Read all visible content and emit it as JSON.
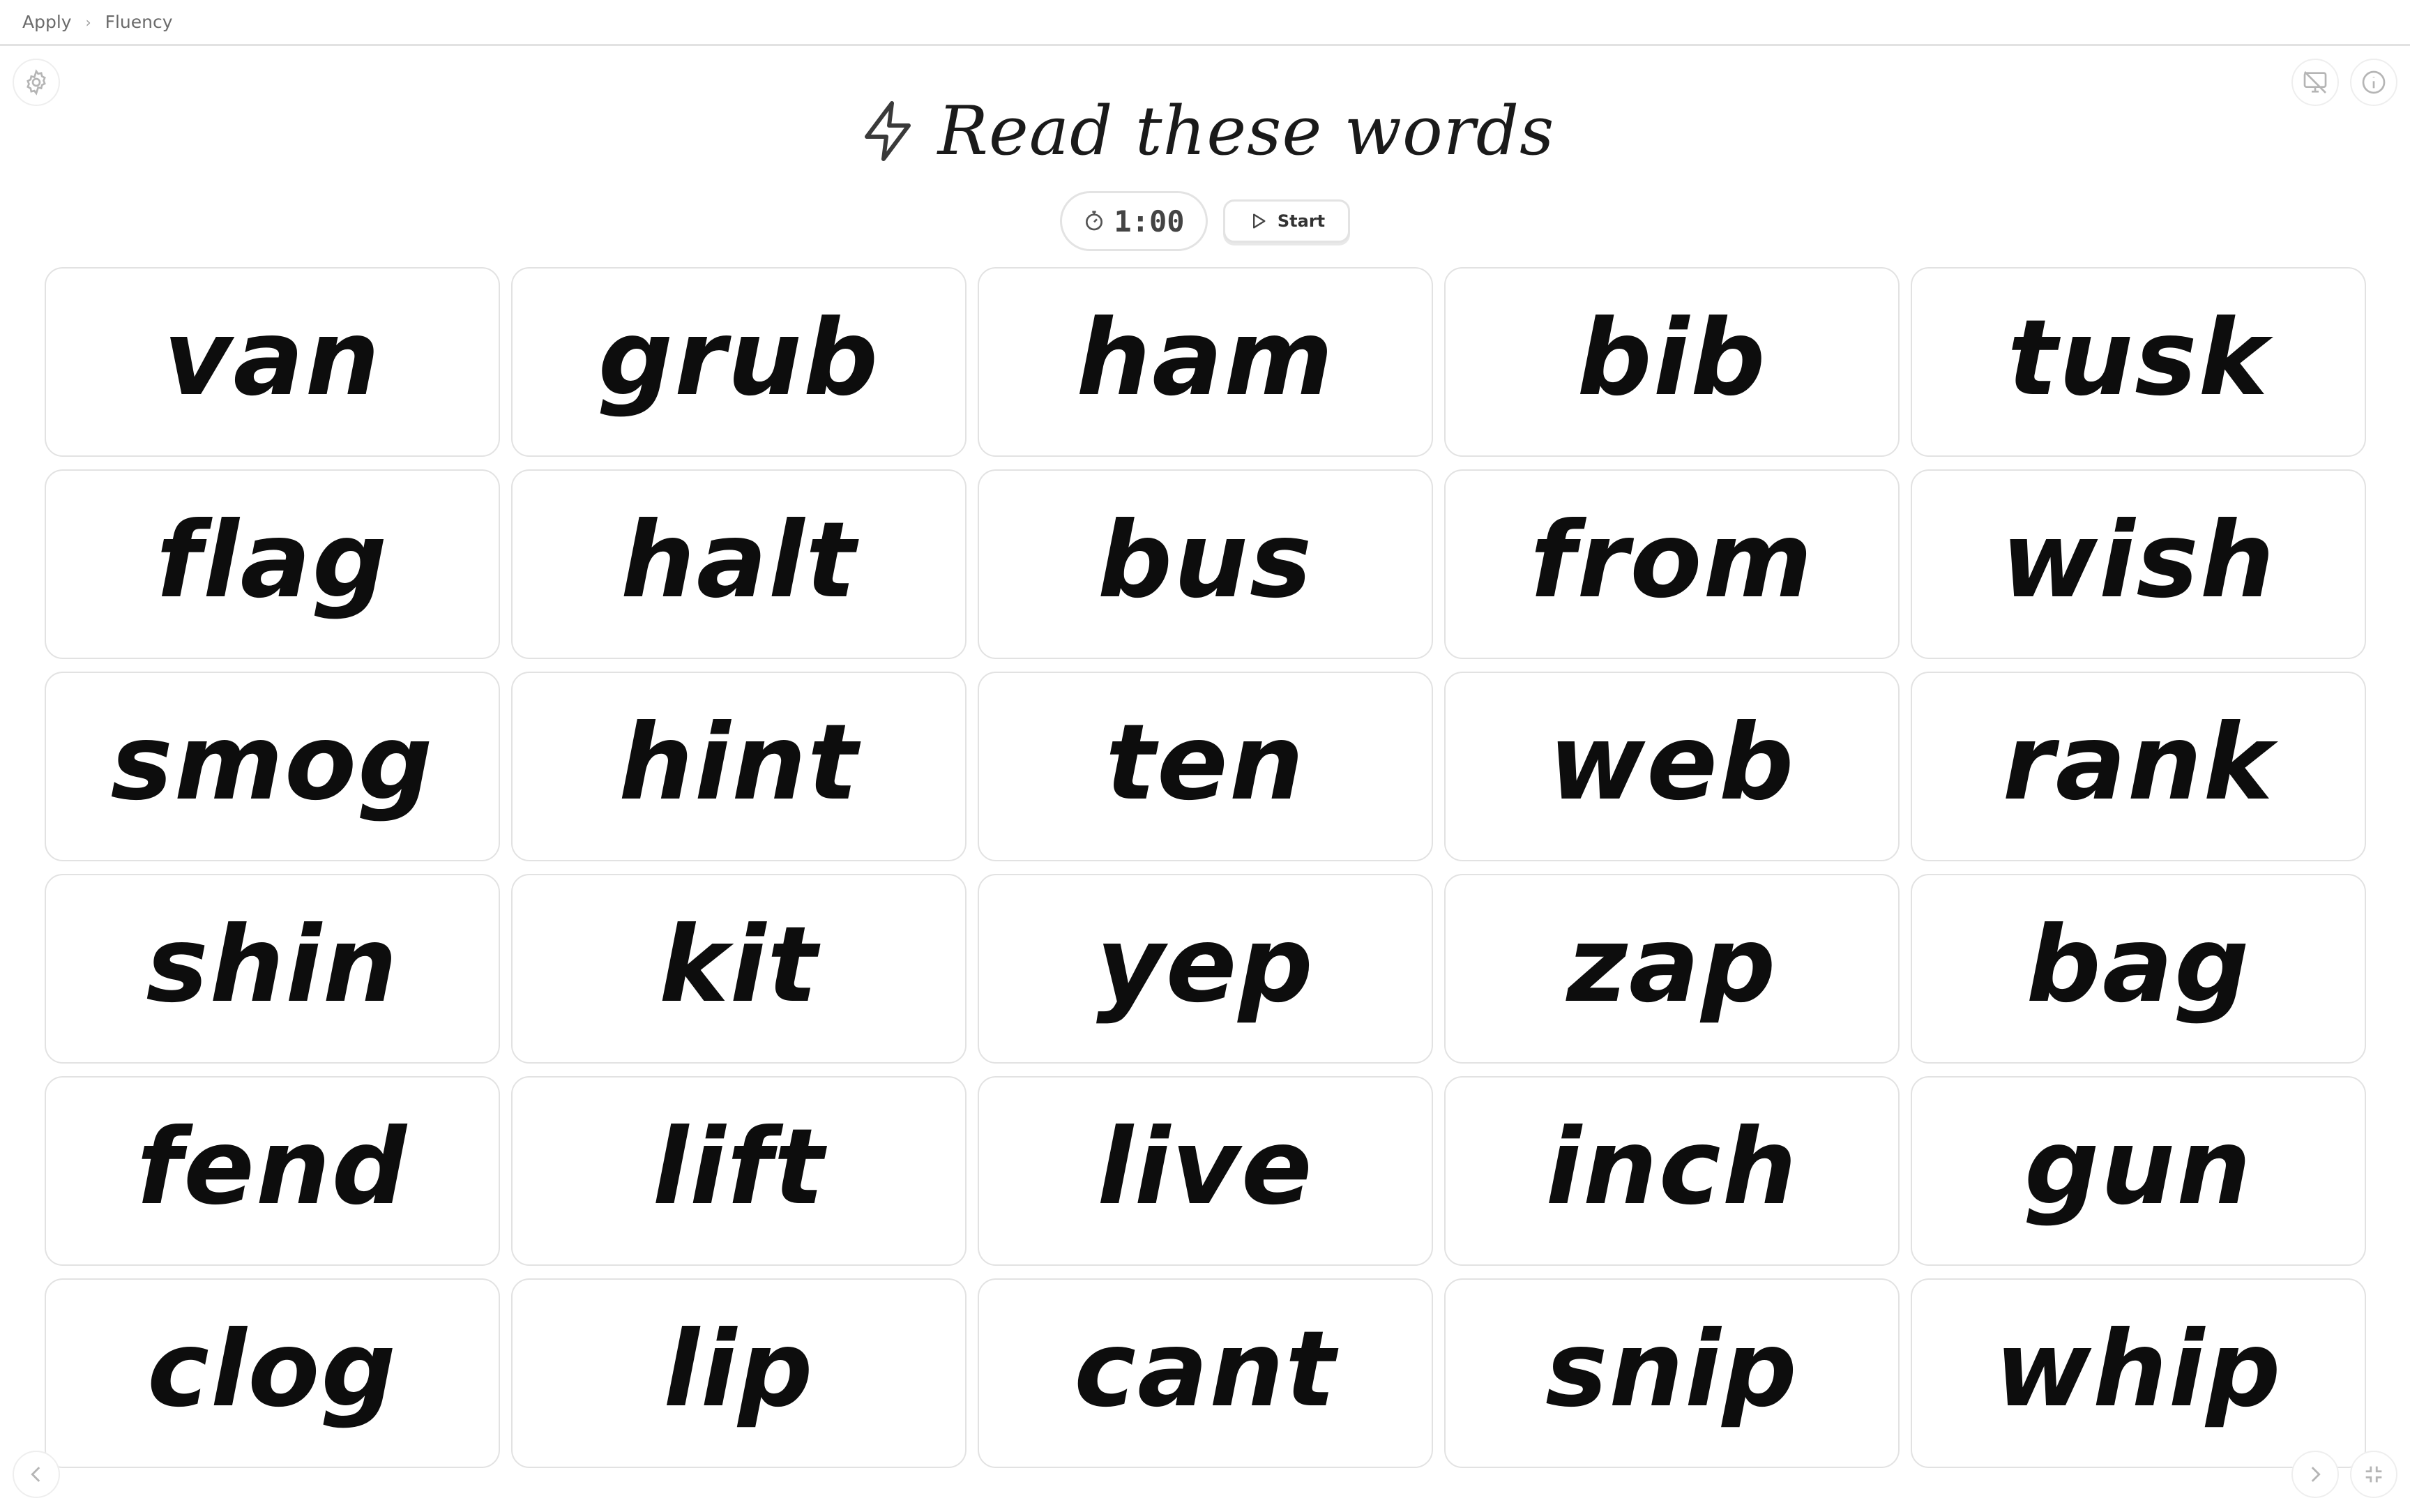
{
  "breadcrumb": [
    "Apply",
    "Fluency"
  ],
  "title": "Read these words",
  "timer": "1:00",
  "start_label": "Start",
  "words": [
    "van",
    "grub",
    "ham",
    "bib",
    "tusk",
    "flag",
    "halt",
    "bus",
    "from",
    "wish",
    "smog",
    "hint",
    "ten",
    "web",
    "rank",
    "shin",
    "kit",
    "yep",
    "zap",
    "bag",
    "fend",
    "lift",
    "live",
    "inch",
    "gun",
    "clog",
    "lip",
    "cant",
    "snip",
    "whip"
  ],
  "icons": {
    "settings": "gear-icon",
    "title": "lightning-icon",
    "timer": "stopwatch-icon",
    "start": "play-icon",
    "screen": "monitor-off-icon",
    "info": "info-icon",
    "prev": "chevron-left-icon",
    "next": "chevron-right-icon",
    "fullscreen": "minimize-icon"
  },
  "colors": {
    "text": "#111111",
    "border": "#e2e2e2",
    "muted": "#6b6b6b"
  }
}
